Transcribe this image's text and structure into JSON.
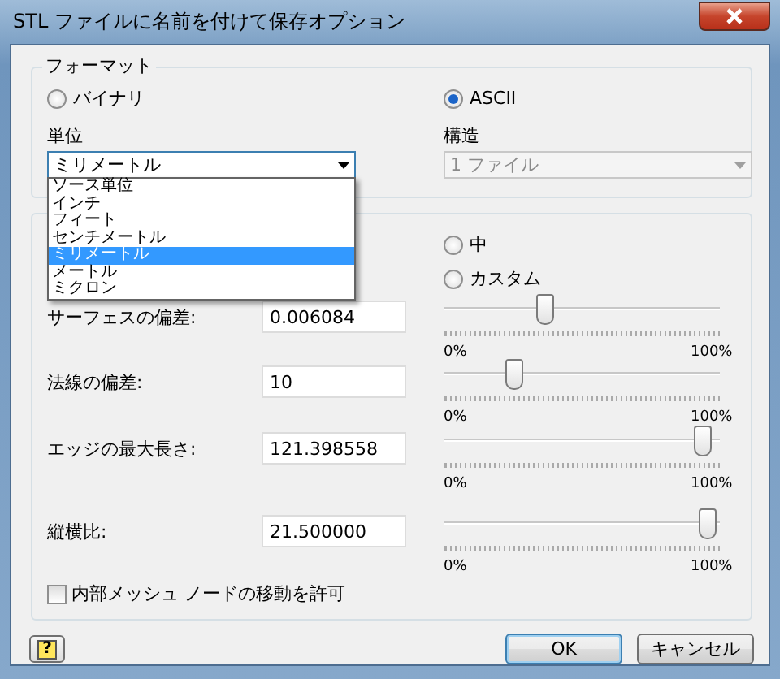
{
  "window": {
    "title": "STL ファイルに名前を付けて保存オプション"
  },
  "format": {
    "title": "フォーマット",
    "options": [
      {
        "label": "バイナリ",
        "selected": false
      },
      {
        "label": "ASCII",
        "selected": true
      }
    ],
    "units": {
      "label": "単位",
      "value": "ミリメートル",
      "expanded": true,
      "options": [
        {
          "label": "ソース単位",
          "selected": false
        },
        {
          "label": "インチ",
          "selected": false
        },
        {
          "label": "フィート",
          "selected": false
        },
        {
          "label": "センチメートル",
          "selected": false
        },
        {
          "label": "ミリメートル",
          "selected": true
        },
        {
          "label": "メートル",
          "selected": false
        },
        {
          "label": "ミクロン",
          "selected": false
        }
      ]
    },
    "structure": {
      "label": "構造",
      "value": "1 ファイル",
      "disabled": true
    }
  },
  "resolution": {
    "options": [
      {
        "label": "中",
        "selected": false
      },
      {
        "label": "カスタム",
        "selected": false
      }
    ],
    "rows": [
      {
        "label": "サーフェスの偏差:",
        "value": "0.006084",
        "level": 0.36,
        "min_label": "0%",
        "max_label": "100%"
      },
      {
        "label": "法線の偏差:",
        "value": "10",
        "level": 0.24,
        "min_label": "0%",
        "max_label": "100%"
      },
      {
        "label": "エッジの最大長さ:",
        "value": "121.398558",
        "level": 0.97,
        "min_label": "0%",
        "max_label": "100%"
      },
      {
        "label": "縦横比:",
        "value": "21.500000",
        "level": 0.99,
        "min_label": "0%",
        "max_label": "100%"
      }
    ],
    "checkbox": {
      "label": "内部メッシュ ノードの移動を許可",
      "checked": false
    }
  },
  "buttons": [
    {
      "kind": "help",
      "label": "?"
    },
    {
      "kind": "default",
      "label": "OK"
    },
    {
      "kind": "normal",
      "label": "キャンセル"
    }
  ]
}
